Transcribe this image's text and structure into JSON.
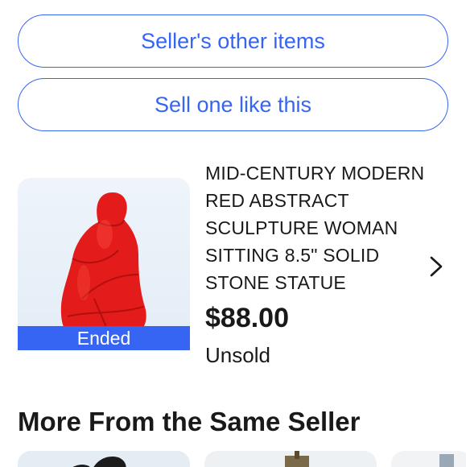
{
  "buttons": {
    "sellers_other_items": "Seller's other items",
    "sell_one_like_this": "Sell one like this"
  },
  "item": {
    "title": "MID-CENTURY MODERN RED ABSTRACT SCULPTURE WOMAN SITTING 8.5\" SOLID STONE STATUE",
    "price": "$88.00",
    "status": "Unsold",
    "badge": "Ended"
  },
  "section": {
    "heading": "More From the Same Seller"
  },
  "colors": {
    "accent": "#3665f3",
    "text": "#191919",
    "sculpture_red": "#e31b1b"
  },
  "icons": {
    "chevron": "chevron-right-icon"
  }
}
